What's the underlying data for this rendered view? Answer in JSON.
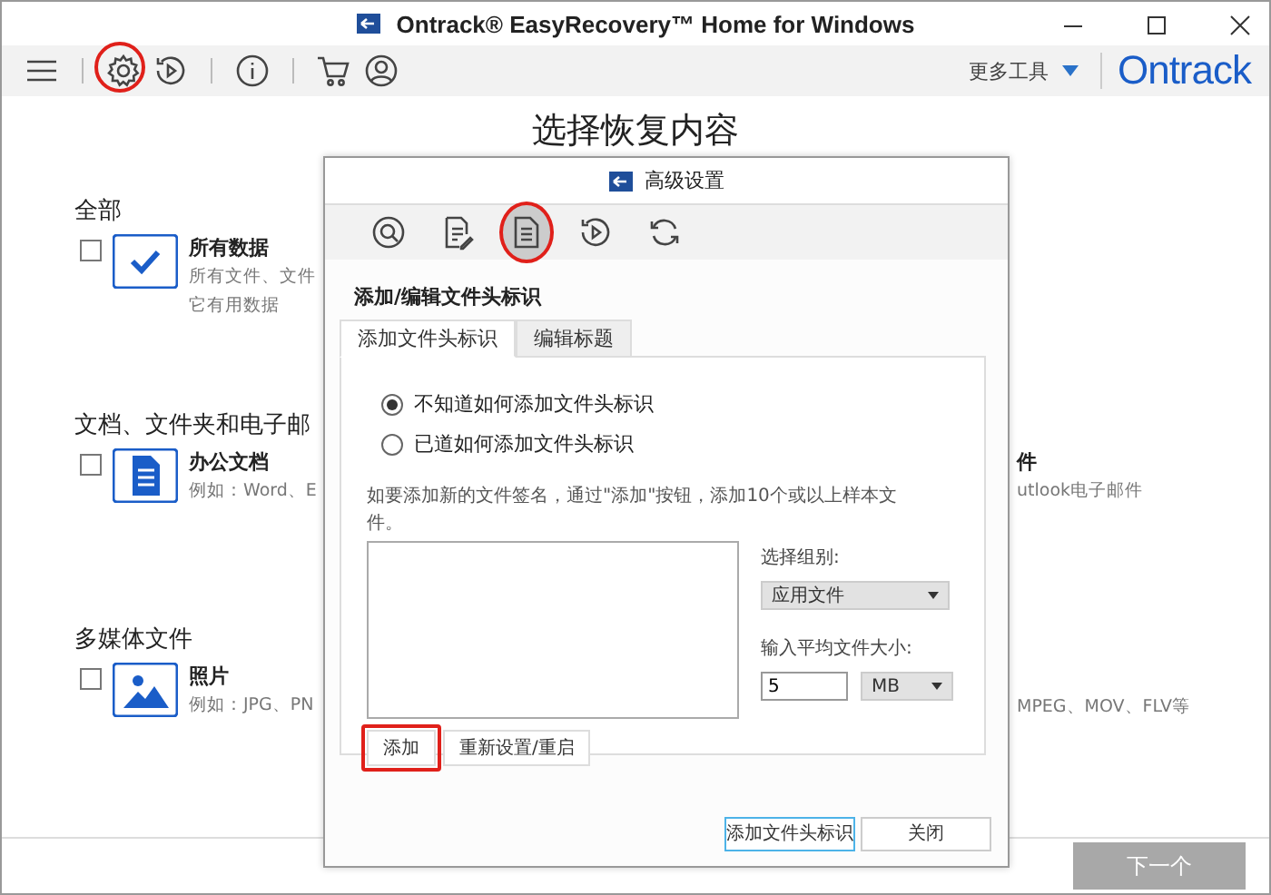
{
  "window": {
    "title": "Ontrack® EasyRecovery™ Home for Windows"
  },
  "toolbar": {
    "tools": [
      {
        "kind": "menu",
        "highlighted": false
      },
      {
        "kind": "gear",
        "highlighted": true
      },
      {
        "kind": "replay",
        "highlighted": false
      },
      {
        "kind": "info",
        "highlighted": false
      },
      {
        "kind": "cart",
        "highlighted": false
      },
      {
        "kind": "user",
        "highlighted": false
      }
    ],
    "more_tools": "更多工具",
    "logo": "Ontrack"
  },
  "main": {
    "heading": "选择恢复内容",
    "sections": [
      {
        "title": "全部",
        "items": [
          {
            "title": "所有数据",
            "description": [
              "所有文件、文件",
              "它有用数据"
            ],
            "checked": false,
            "kind": "check"
          }
        ]
      },
      {
        "title": "文档、文件夹和电子邮",
        "items": [
          {
            "title": "办公文档",
            "description": [
              "例如：Word、E"
            ],
            "checked": false,
            "kind": "document"
          },
          {
            "title": "件",
            "description": [
              "utlook电子邮件"
            ]
          }
        ]
      },
      {
        "title": "多媒体文件",
        "items": [
          {
            "title": "照片",
            "description": [
              "例如：JPG、PN"
            ],
            "checked": false,
            "kind": "image"
          },
          {
            "description": [
              "MPEG、MOV、FLV等"
            ]
          }
        ]
      }
    ]
  },
  "dialog": {
    "title": "高级设置",
    "tools": [
      {
        "kind": "search",
        "selected": false,
        "highlighted": false
      },
      {
        "kind": "doc-edit",
        "selected": false,
        "highlighted": false
      },
      {
        "kind": "doc",
        "selected": true,
        "highlighted": true
      },
      {
        "kind": "replay",
        "selected": false,
        "highlighted": false
      },
      {
        "kind": "refresh",
        "selected": false,
        "highlighted": false
      }
    ],
    "heading": "添加/编辑文件头标识",
    "tabs": [
      {
        "label": "添加文件头标识",
        "selected": true
      },
      {
        "label": "编辑标题",
        "selected": false
      }
    ],
    "radios": [
      {
        "label": "不知道如何添加文件头标识",
        "selected": true
      },
      {
        "label": "已道如何添加文件头标识",
        "selected": false
      }
    ],
    "instructions": "如要添加新的文件签名，通过\"添加\"按钮，添加10个或以上样本文件。",
    "group_label": "选择组别:",
    "group_select": "应用文件",
    "size_label": "输入平均文件大小:",
    "size_value": "5",
    "unit_select": "MB",
    "buttons": [
      {
        "label": "添加",
        "highlighted": true
      },
      {
        "label": "重新设置/重启",
        "highlighted": false
      }
    ],
    "footer_buttons": [
      {
        "label": "添加文件头标识",
        "default": true
      },
      {
        "label": "关闭",
        "default": false
      }
    ]
  },
  "next_button": {
    "label": "下一个",
    "disabled": true
  }
}
